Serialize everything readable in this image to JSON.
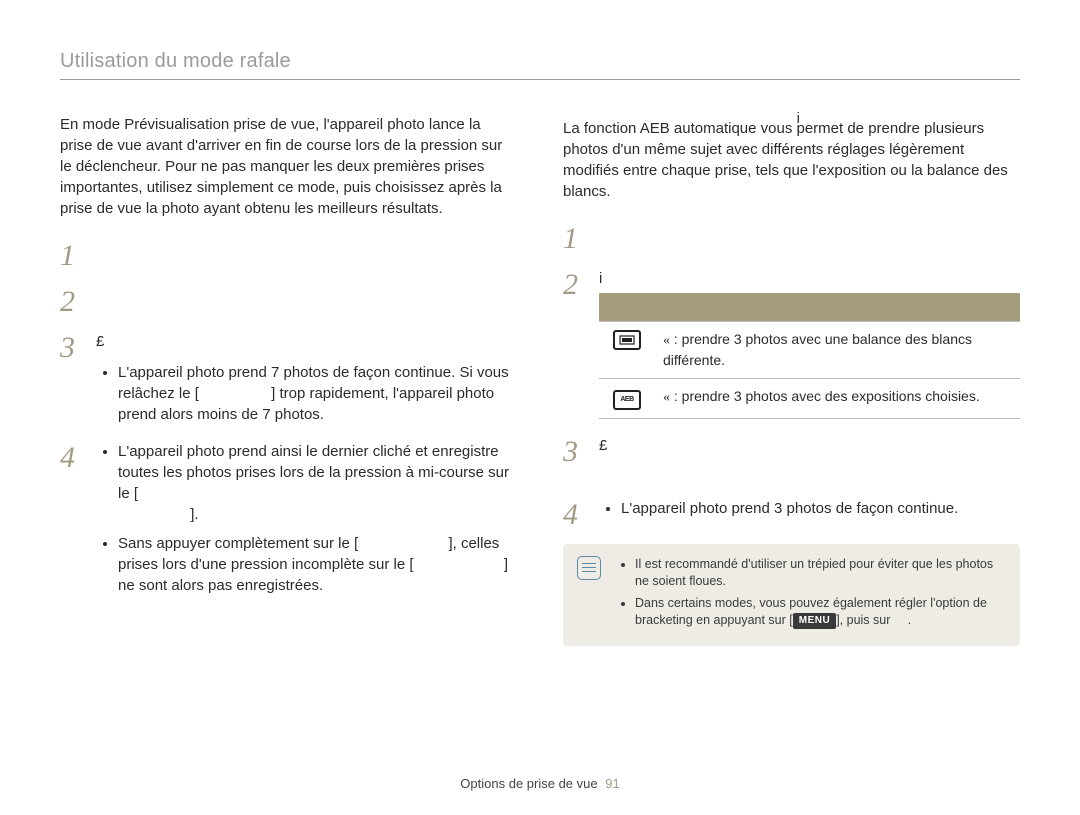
{
  "header": {
    "title": "Utilisation du mode rafale"
  },
  "left": {
    "section_title": "",
    "intro": "En mode Prévisualisation prise de vue, l'appareil photo lance la prise de vue avant d'arriver en fin de course lors de la pression sur le déclencheur. Pour ne pas manquer les deux premières prises importantes, utilisez simplement ce mode, puis choisissez après la prise de vue la photo ayant obtenu les meilleurs résultats.",
    "steps": {
      "s1": "",
      "s2": "",
      "s3_lead": "",
      "s3_sym": "£",
      "s3_tail": "",
      "s3_bullet1_a": "L'appareil photo prend 7 photos de façon continue. Si vous relâchez le [",
      "s3_bullet1_mid": "",
      "s3_bullet1_b": "] trop rapidement, l'appareil photo prend alors moins de 7 photos.",
      "s4": "",
      "s4_bullet1_a": "L'appareil photo prend ainsi le dernier cliché et enregistre toutes les photos prises lors de la pression à mi-course sur le [",
      "s4_bullet1_b": "].",
      "s4_bullet2_a": "Sans appuyer complètement sur le [",
      "s4_bullet2_b": "], celles prises lors d'une pression incomplète sur le [",
      "s4_bullet2_c": "] ne sont alors pas enregistrées."
    }
  },
  "right": {
    "heading_glyph": "i",
    "intro": "La fonction AEB automatique vous permet de prendre plusieurs photos d'un même sujet avec différents réglages légèrement modifiés entre chaque prise, tels que l'exposition ou la balance des blancs.",
    "s1": "",
    "s2_lead": "",
    "s2_sym": "i",
    "s2_tail": "",
    "table": {
      "h_icon": "",
      "h_desc": "",
      "row1": {
        "q": "«",
        "pre": "",
        "text": " : prendre 3 photos avec une balance des blancs différente."
      },
      "row2": {
        "q": "«",
        "pre": "",
        "text": " : prendre 3 photos avec des expositions choisies."
      }
    },
    "s3_lead": "",
    "s3_sym": "£",
    "s3_tail": "",
    "s4": "",
    "s4_bullet": "L'appareil photo prend 3 photos de façon continue.",
    "note": {
      "li1": "Il est recommandé d'utiliser un trépied pour éviter que les photos ne soient floues.",
      "li2_a": "Dans certains modes, vous pouvez également régler l'option de bracketing en appuyant sur [",
      "li2_menu": "MENU",
      "li2_b": "], puis sur",
      "li2_c": "."
    }
  },
  "footer": {
    "section": "Options de prise de vue",
    "page": "91"
  }
}
